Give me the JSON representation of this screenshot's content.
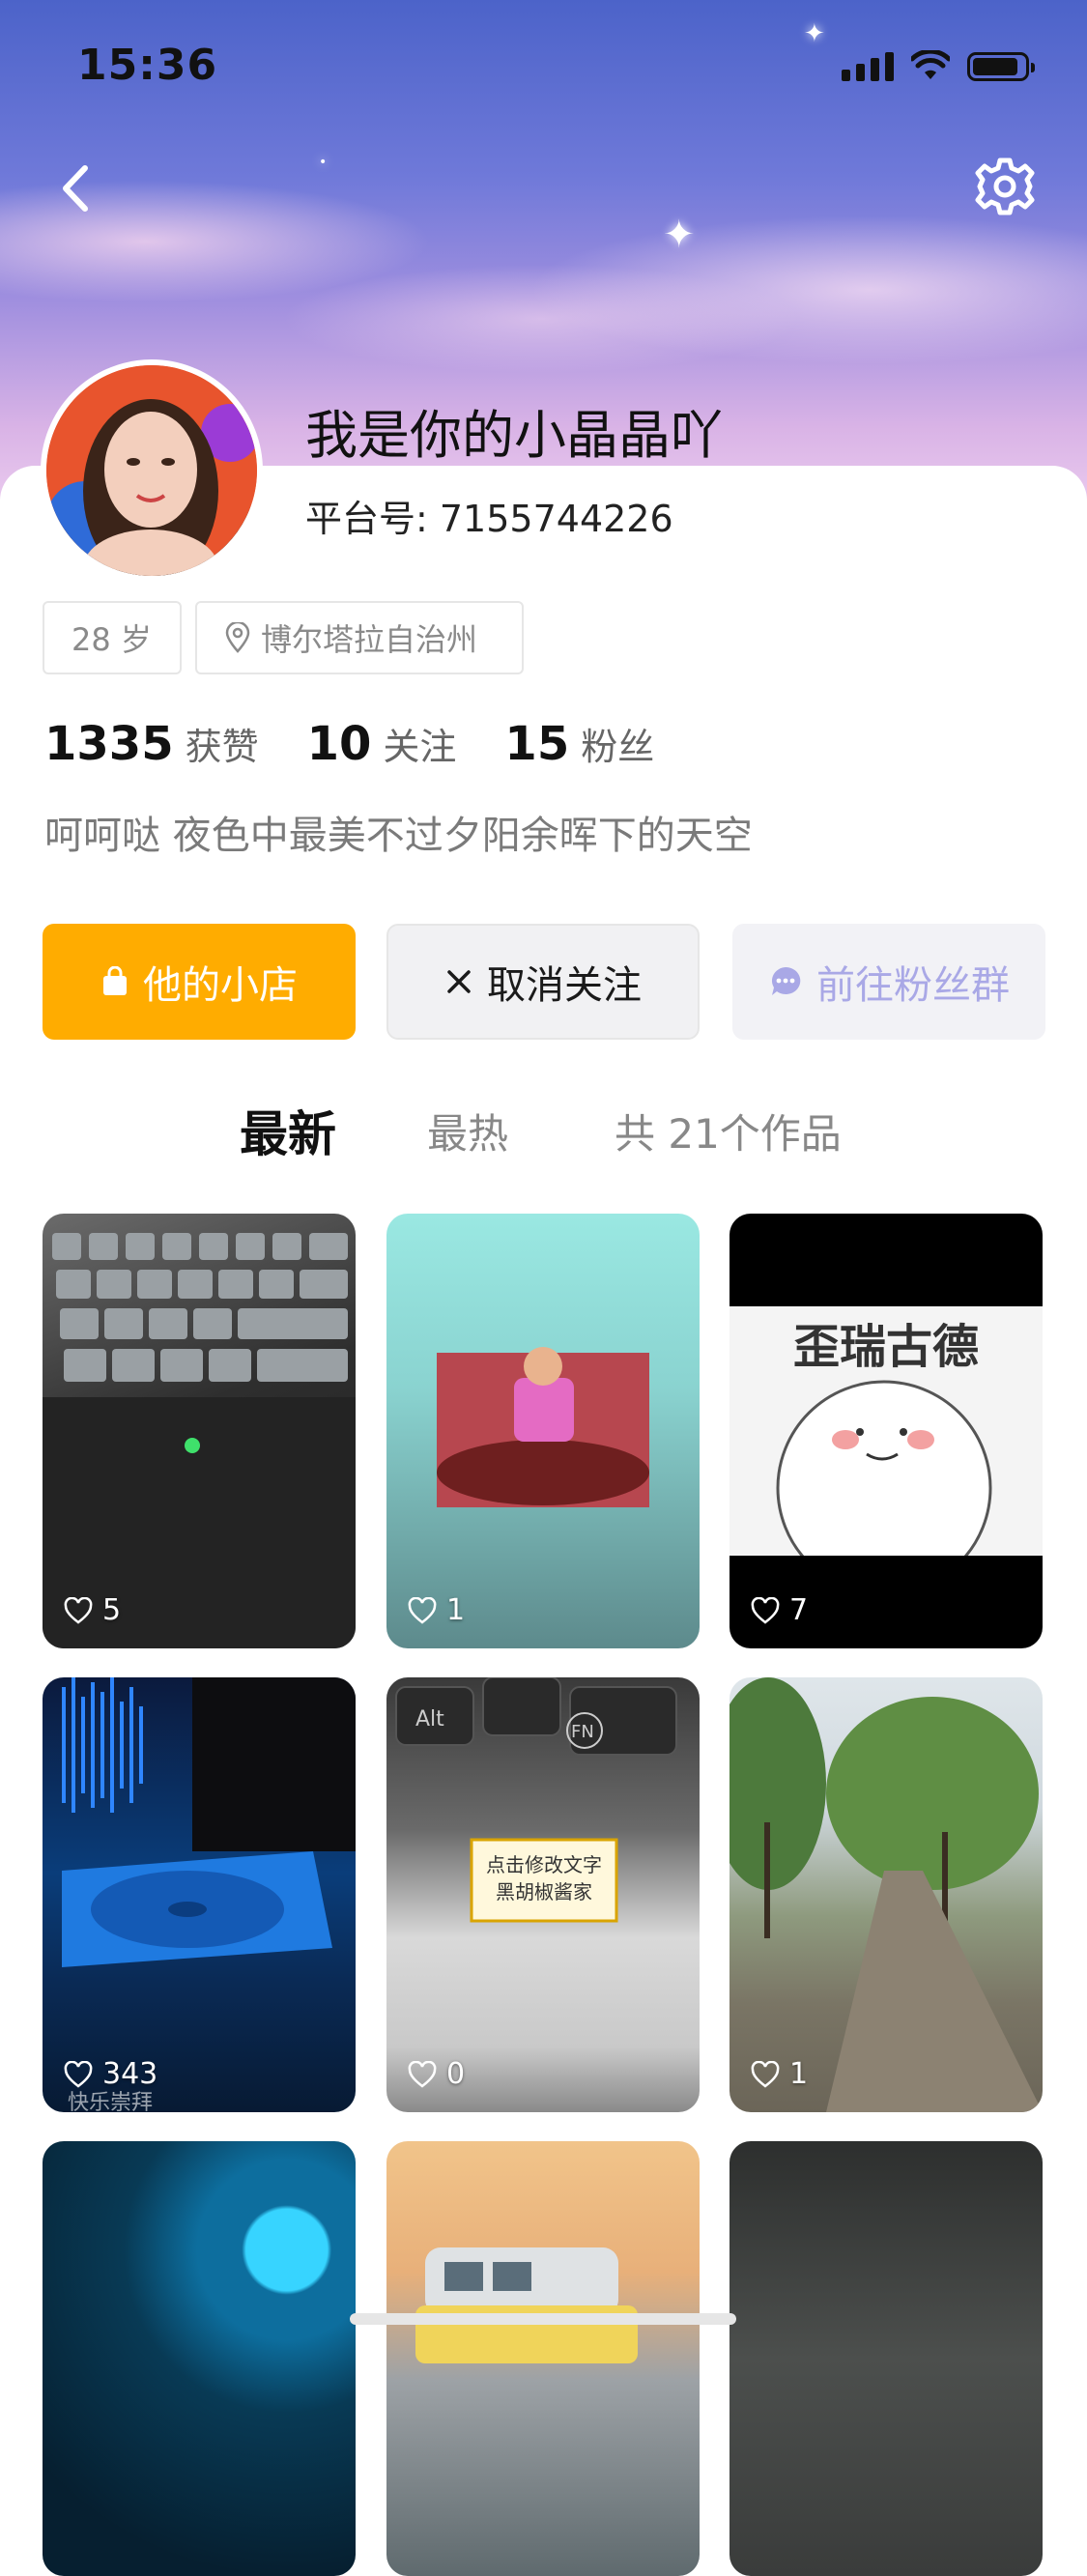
{
  "status_bar": {
    "time": "15:36"
  },
  "header": {
    "back_icon": "chevron-left-icon",
    "settings_icon": "gear-icon"
  },
  "profile": {
    "nickname": "我是你的小晶晶吖",
    "platform_id": "平台号: 7155744226",
    "age_tag": "28 岁",
    "location_tag": "博尔塔拉自治州",
    "stats": [
      {
        "value": "1335",
        "label": "获赞"
      },
      {
        "value": "10",
        "label": "关注"
      },
      {
        "value": "15",
        "label": "粉丝"
      }
    ],
    "bio": "呵呵哒 夜色中最美不过夕阳余晖下的天空"
  },
  "actions": {
    "shop": "他的小店",
    "unfollow": "取消关注",
    "fans_group": "前往粉丝群"
  },
  "tabs": {
    "latest": "最新",
    "hot": "最热",
    "works_count": "共 21个作品"
  },
  "grid": [
    {
      "likes": "5"
    },
    {
      "likes": "1"
    },
    {
      "likes": "7",
      "caption": "歪瑞古德"
    },
    {
      "likes": "343",
      "caption": "快乐崇拜"
    },
    {
      "likes": "0",
      "caption": "点击修改文字\n黑胡椒酱家"
    },
    {
      "likes": "1"
    },
    {},
    {},
    {}
  ],
  "colors": {
    "accent_orange": "#ffac00",
    "fans_purple": "#a9a8e6"
  }
}
